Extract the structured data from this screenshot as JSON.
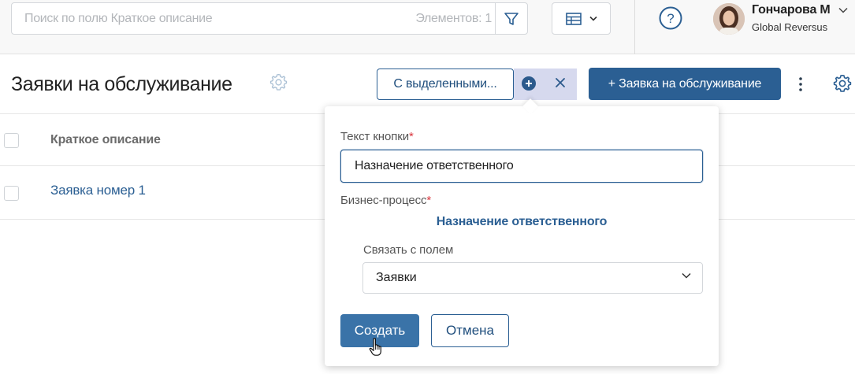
{
  "topbar": {
    "search_placeholder": "Поиск по полю Краткое описание",
    "items_count": "Элементов: 1",
    "help_icon": "help-circle-icon",
    "user": {
      "name": "Гончарова М",
      "company": "Global Reversus"
    }
  },
  "page": {
    "title": "Заявки на обслуживание",
    "selected_button": "С выделенными...",
    "add_button": "+ Заявка на обслуживание"
  },
  "table": {
    "column_header": "Краткое описание",
    "rows": [
      {
        "title": "Заявка номер 1"
      }
    ]
  },
  "popover": {
    "button_text_label": "Текст кнопки",
    "button_text_value": "Назначение ответственного",
    "process_label": "Бизнес-процесс",
    "process_value": "Назначение ответственного",
    "link_field_label": "Связать с полем",
    "link_field_value": "Заявки",
    "required_mark": "*",
    "create_button": "Создать",
    "cancel_button": "Отмена"
  },
  "colors": {
    "primary": "#2b5f93",
    "create_button": "#3a73a8",
    "highlight": "#d6d9ee",
    "required": "#d9363e"
  }
}
